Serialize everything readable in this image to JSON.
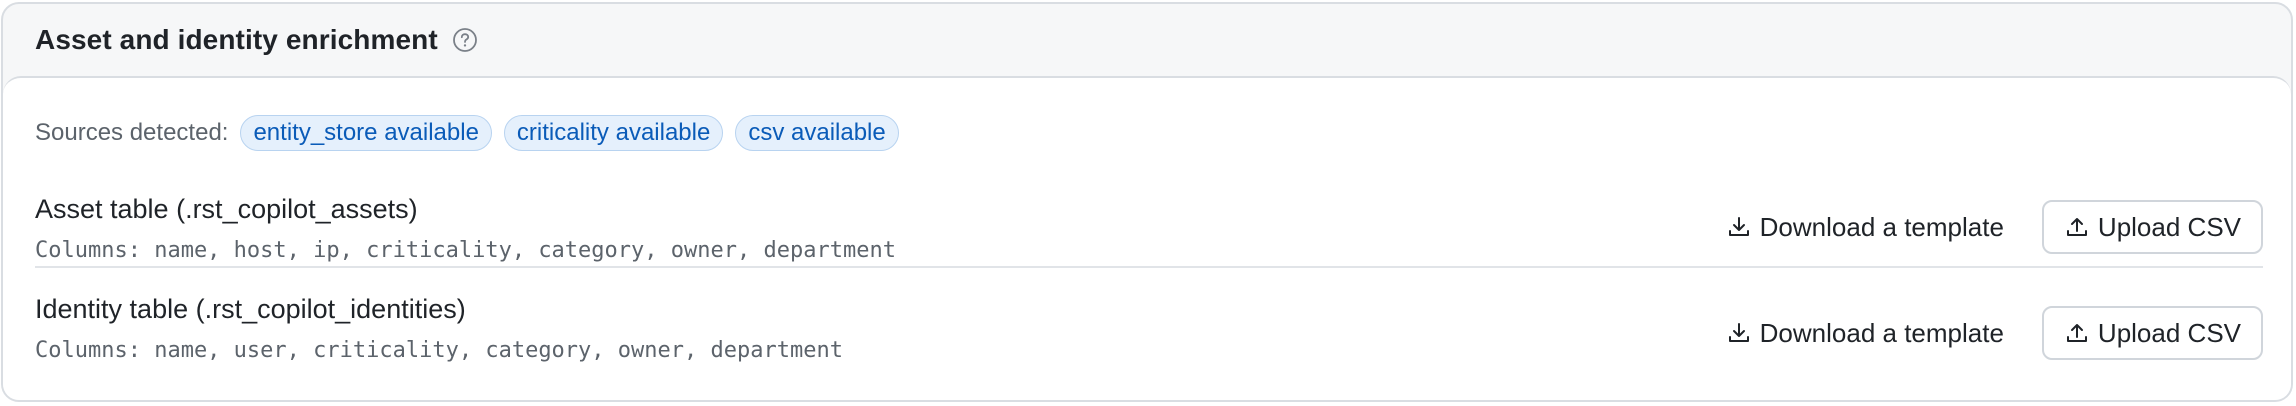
{
  "panel": {
    "title": "Asset and identity enrichment",
    "help_icon": "question-circle-icon"
  },
  "sources": {
    "label": "Sources detected:",
    "badges": [
      {
        "label": "entity_store available"
      },
      {
        "label": "criticality available"
      },
      {
        "label": "csv available"
      }
    ],
    "colors": {
      "badge_bg": "#e5f0fc",
      "badge_text": "#0a5bb8",
      "badge_border": "#b8d3f0"
    }
  },
  "tables": [
    {
      "title": "Asset table (.rst_copilot_assets)",
      "columns": "Columns: name, host, ip, criticality, category, owner, department",
      "download_label": "Download a template",
      "download_icon": "download-icon",
      "upload_label": "Upload CSV",
      "upload_icon": "upload-icon"
    },
    {
      "title": "Identity table (.rst_copilot_identities)",
      "columns": "Columns: name, user, criticality, category, owner, department",
      "download_label": "Download a template",
      "download_icon": "download-icon",
      "upload_label": "Upload CSV",
      "upload_icon": "upload-icon"
    }
  ]
}
